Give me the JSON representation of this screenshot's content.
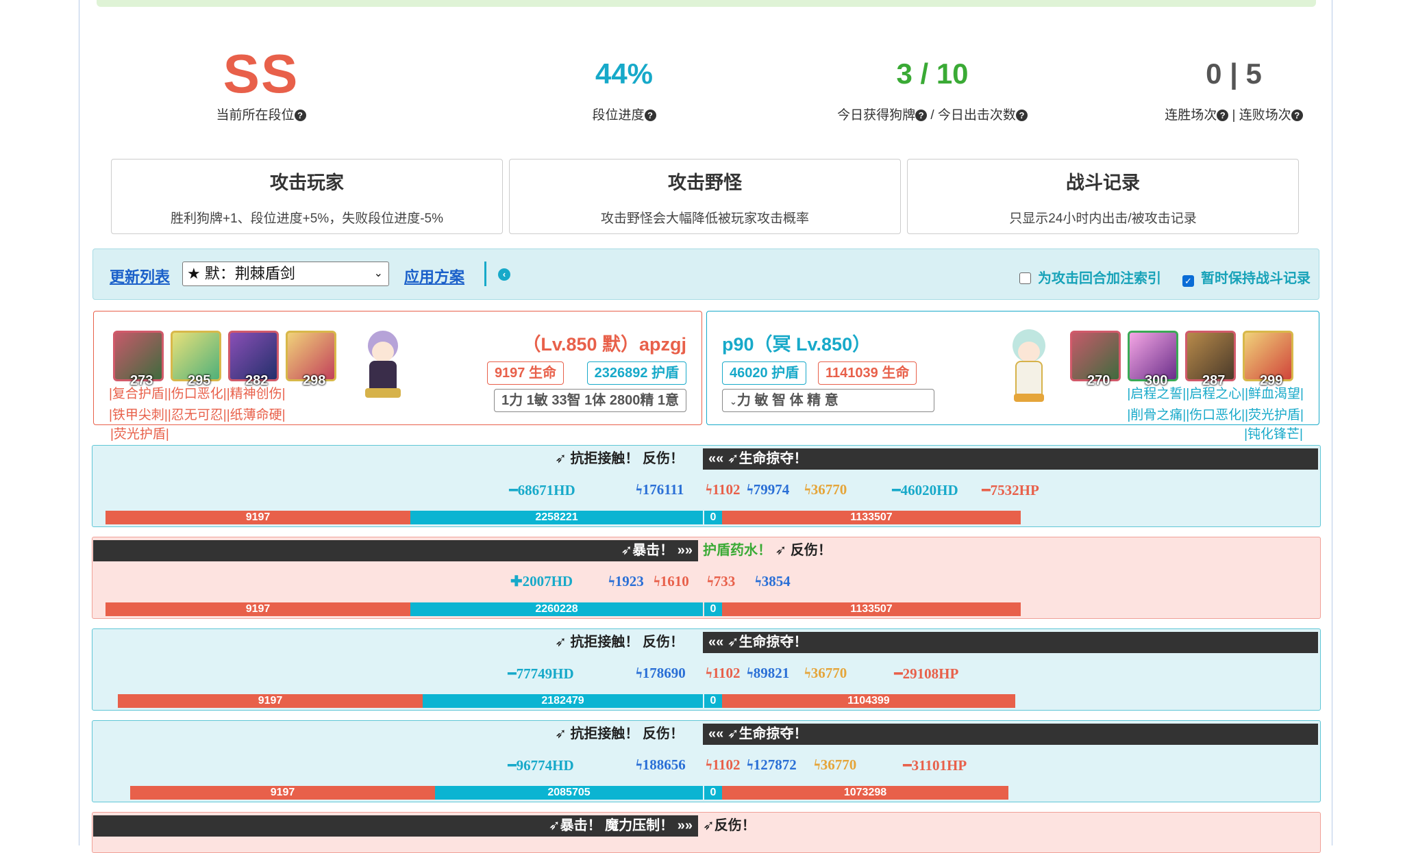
{
  "stats": [
    {
      "value": "SS",
      "label": "当前所在段位",
      "color": "#e8604a"
    },
    {
      "value": "44%",
      "label": "段位进度",
      "color": "#17a9c9"
    },
    {
      "value": "3 / 10",
      "label_a": "今日获得狗牌",
      "label_b": " / 今日出击次数",
      "color": "#3aaa35"
    },
    {
      "value": "0 | 5",
      "label_a": "连胜场次",
      "label_b": " | 连败场次",
      "color": "#555"
    }
  ],
  "cards": [
    {
      "title": "攻击玩家",
      "desc": "胜利狗牌+1、段位进度+5%，失败段位进度-5%"
    },
    {
      "title": "攻击野怪",
      "desc": "攻击野怪会大幅降低被玩家攻击概率"
    },
    {
      "title": "战斗记录",
      "desc": "只显示24小时内出击/被攻击记录"
    }
  ],
  "toolbar": {
    "refresh": "更新列表",
    "select_value": "★ 默：荆棘盾剑",
    "apply": "应用方案",
    "chk1": "为攻击回合加注索引",
    "chk2": "暂时保持战斗记录",
    "chk1_on": false,
    "chk2_on": true
  },
  "player": {
    "name": "（Lv.850 默）apzgj",
    "hp": "9197 生命",
    "shield": "2326892 护盾",
    "attrs": "1力 1敏 33智 1体 2800精 1意",
    "equip": [
      "273",
      "295",
      "282",
      "298"
    ],
    "tags": [
      "|复合护盾||伤口恶化||精神创伤|",
      "|铁甲尖刺||忍无可忍||纸薄命硬|",
      "|荧光护盾|"
    ]
  },
  "enemy": {
    "name": "p90（冥 Lv.850）",
    "shield": "46020 护盾",
    "hp": "1141039 生命",
    "attrs": "力 敏 智 体 精 意",
    "equip": [
      "270",
      "300",
      "287",
      "299"
    ],
    "tags": [
      "|启程之誓||启程之心||鲜血渴望|",
      "|削骨之痛||伤口恶化||荧光护盾|",
      "|钝化锋芒|"
    ]
  },
  "rows": [
    {
      "type": "blue",
      "left": "抗拒接触！ 反伤！",
      "right": "生命掠夺！",
      "n1": "━68671HD",
      "n2": "176111",
      "n3": "1102",
      "n4": "79974",
      "n5": "36770",
      "n6": "━46020HD",
      "n7": "━7532HP",
      "hp": "9197",
      "sh": "2258221",
      "ehp0": "0",
      "ehp": "1133507",
      "hp_frac": 0.5,
      "sh_frac": 0.48,
      "ehp_frac": 0.5
    },
    {
      "type": "pink",
      "left": "暴击！",
      "right_g": "护盾药水！",
      "right": " 反伤！",
      "n1": "✚2007HD",
      "n2": "1923",
      "n3": "1610",
      "n4": "733",
      "n5": "3854",
      "hp": "9197",
      "sh": "2260228",
      "ehp0": "0",
      "ehp": "1133507",
      "hp_frac": 0.5,
      "sh_frac": 0.48,
      "ehp_frac": 0.5
    },
    {
      "type": "blue",
      "left": "抗拒接触！ 反伤！",
      "right": "生命掠夺！",
      "n1": "━77749HD",
      "n2": "178690",
      "n3": "1102",
      "n4": "89821",
      "n5": "36770",
      "n7": "━29108HP",
      "hp": "9197",
      "sh": "2182479",
      "ehp0": "0",
      "ehp": "1104399",
      "hp_frac": 0.5,
      "sh_frac": 0.46,
      "ehp_frac": 0.49
    },
    {
      "type": "blue",
      "left": "抗拒接触！ 反伤！",
      "right": "生命掠夺！",
      "n1": "━96774HD",
      "n2": "188656",
      "n3": "1102",
      "n4": "127872",
      "n5": "36770",
      "n7": "━31101HP",
      "hp": "9197",
      "sh": "2085705",
      "ehp0": "0",
      "ehp": "1073298",
      "hp_frac": 0.5,
      "sh_frac": 0.44,
      "ehp_frac": 0.47
    },
    {
      "type": "pink",
      "left": "暴击！ 魔力压制！",
      "right": "反伤！"
    }
  ]
}
